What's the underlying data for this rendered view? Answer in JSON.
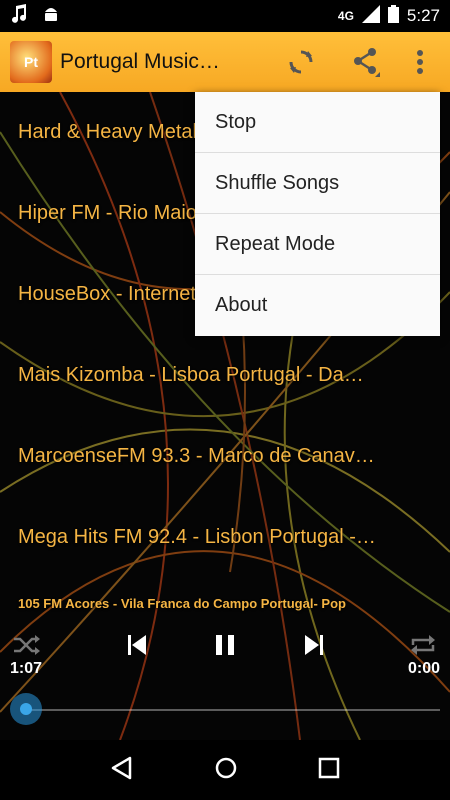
{
  "status_bar": {
    "network": "4G",
    "time": "5:27",
    "icons": [
      "music-note-icon",
      "android-icon",
      "signal-icon",
      "battery-icon"
    ]
  },
  "action_bar": {
    "app_icon_text": "Pt",
    "title": "Portugal Music…",
    "icons": [
      "refresh-icon",
      "share-icon",
      "overflow-menu-icon"
    ],
    "background_color": "#f7a823"
  },
  "stations": [
    {
      "label": "Hard & Heavy Metal"
    },
    {
      "label": "Hiper FM  - Rio Maior Portugal"
    },
    {
      "label": "HouseBox  - Internet Portugal"
    },
    {
      "label": "Mais Kizomba - Lisboa Portugal - Da…"
    },
    {
      "label": "MarcoenseFM 93.3 - Marco de Canav…"
    },
    {
      "label": "Mega Hits FM 92.4  - Lisbon Portugal -…"
    }
  ],
  "player": {
    "now_playing": "105 FM Acores  -  Vila Franca do Campo Portugal-  Pop",
    "elapsed": "1:07",
    "total": "0:00",
    "progress": 0,
    "controls": [
      "shuffle-icon",
      "previous-icon",
      "pause-icon",
      "next-icon",
      "repeat-icon"
    ]
  },
  "menu": {
    "items": [
      {
        "label": "Stop"
      },
      {
        "label": "Shuffle Songs"
      },
      {
        "label": "Repeat Mode"
      },
      {
        "label": "About"
      }
    ]
  },
  "nav_bar": {
    "icons": [
      "back-icon",
      "home-icon",
      "recents-icon"
    ]
  },
  "colors": {
    "accent": "#f5b544",
    "seek_thumb": "#3aa6e8"
  }
}
